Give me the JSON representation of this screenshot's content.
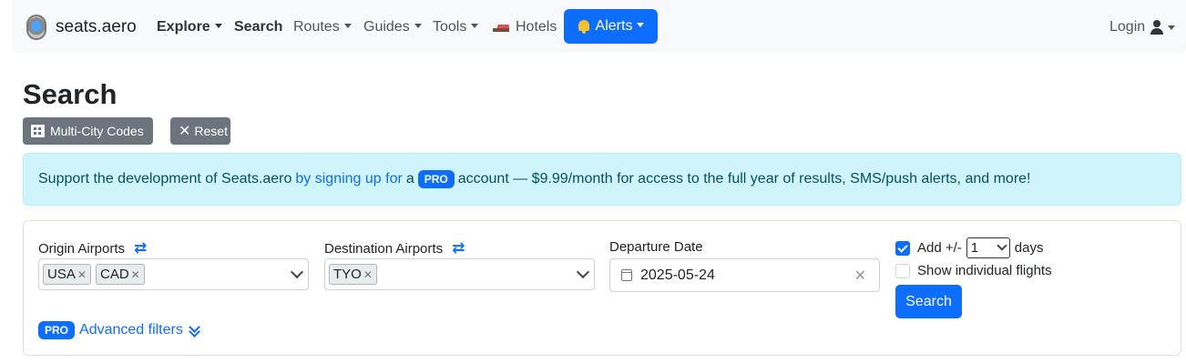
{
  "navbar": {
    "brand": "seats.aero",
    "items": [
      {
        "label": "Explore",
        "caret": true
      },
      {
        "label": "Search",
        "caret": false
      },
      {
        "label": "Routes",
        "caret": true
      },
      {
        "label": "Guides",
        "caret": true
      },
      {
        "label": "Tools",
        "caret": true
      },
      {
        "label": "Hotels",
        "icon": "bed-icon"
      }
    ],
    "alerts_label": "Alerts",
    "login_label": "Login"
  },
  "page": {
    "title": "Search",
    "multi_city_label": "Multi-City Codes",
    "reset_label": "Reset"
  },
  "promo": {
    "text_before": "Support the development of Seats.aero",
    "link_text": "by signing up for",
    "text_mid": "a",
    "badge": "PRO",
    "text_after": "account — $9.99/month for access to the full year of results, SMS/push alerts, and more!"
  },
  "form": {
    "origin_label": "Origin Airports",
    "origin_tags": [
      "USA",
      "CAD"
    ],
    "destination_label": "Destination Airports",
    "destination_tags": [
      "TYO"
    ],
    "departure_label": "Departure Date",
    "departure_value": "2025-05-24",
    "add_days_checked": true,
    "add_days_label": "Add +/-",
    "add_days_value": "1",
    "days_label": "days",
    "show_individual_checked": false,
    "show_individual_label": "Show individual flights",
    "search_label": "Search",
    "advanced_badge": "PRO",
    "advanced_label": "Advanced filters"
  },
  "colors": {
    "primary": "#0d6efd",
    "secondary": "#6c757d",
    "info_bg": "#cff4fc",
    "info_text": "#055160"
  }
}
